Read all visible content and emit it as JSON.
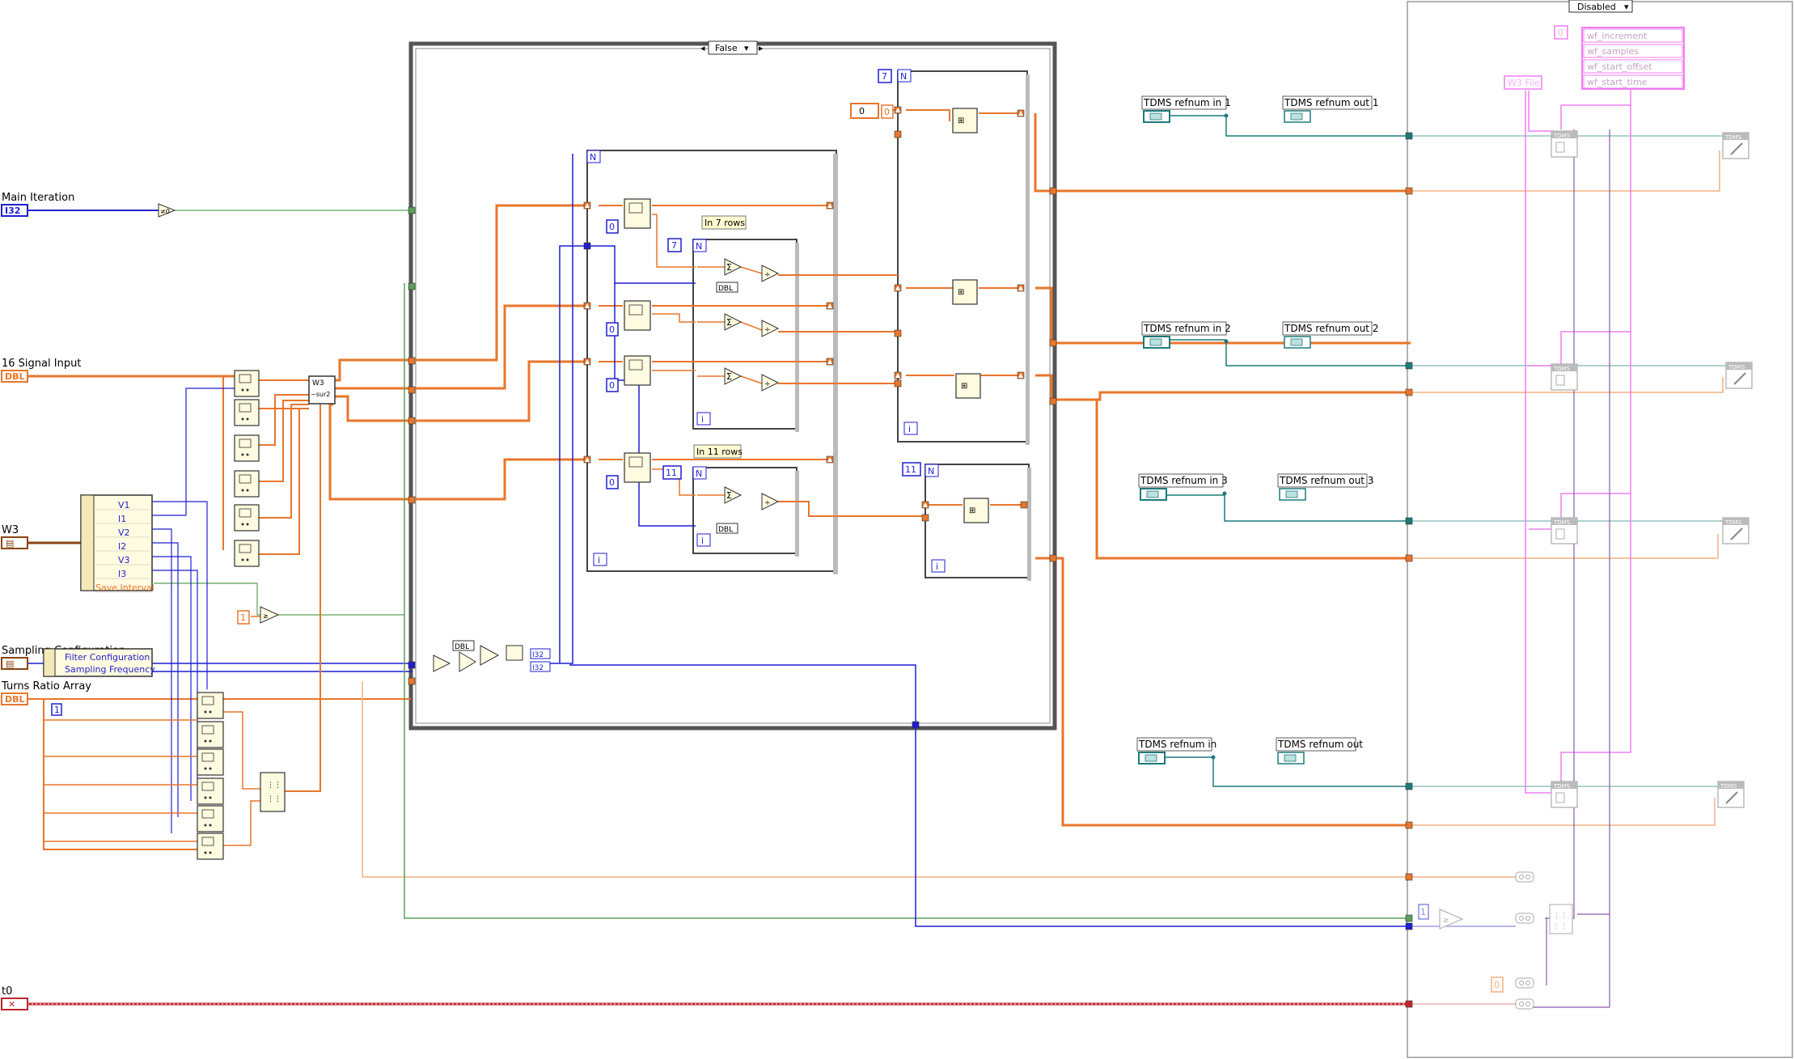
{
  "colors": {
    "orange": "#e8762b",
    "orange_light": "#f4b183",
    "blue": "#1f1fd0",
    "green": "#5aa05a",
    "teal": "#1e7a7a",
    "teal_light": "#7fb8b8",
    "red": "#c0262c",
    "pink": "#f07ef0",
    "pink_light": "#f5b3f5",
    "gray": "#777777"
  },
  "case_structure": {
    "selector": "False"
  },
  "disabled_structure": {
    "selector": "Disabled"
  },
  "controls": {
    "main_iteration": {
      "label": "Main Iteration",
      "type": "I32"
    },
    "signal_input": {
      "label": "16 Signal Input",
      "type": "DBL"
    },
    "w3": {
      "label": "W3"
    },
    "sampling_config": {
      "label": "Sampling Configuration"
    },
    "turns_ratio": {
      "label": "Turns Ratio Array",
      "type": "DBL"
    },
    "t0": {
      "label": "t0"
    }
  },
  "bundle": {
    "items": [
      "V1",
      "I1",
      "V2",
      "I2",
      "V3",
      "I3",
      "Save Interval"
    ]
  },
  "cluster_unbundle": {
    "items": [
      "Filter Configuration",
      "Sampling Frequency"
    ]
  },
  "subvi": {
    "label": "W3\n~sur2"
  },
  "constants": {
    "zero_a": "0",
    "zero_b": "0",
    "zero_c": "0",
    "zero_d": "0",
    "zero_e": "0",
    "zero_f": "0",
    "zero_g": "0",
    "one_a": "1",
    "one_b": "1",
    "one_c": "1",
    "seven_a": "7",
    "seven_b": "7",
    "eleven_a": "11",
    "eleven_b": "11"
  },
  "loops": {
    "n_label": "N",
    "i_label": "i",
    "rows7": "In 7 rows",
    "rows11": "In 11 rows"
  },
  "type_labels": {
    "dbl": "DBL",
    "i32": "I32",
    "tdms": "TDMS"
  },
  "tdms": {
    "in1": "TDMS refnum in 1",
    "out1": "TDMS refnum out 1",
    "in2": "TDMS refnum in 2",
    "out2": "TDMS refnum out 2",
    "in3": "TDMS refnum in 3",
    "out3": "TDMS refnum out 3",
    "in4": "TDMS refnum in",
    "out4": "TDMS refnum out"
  },
  "waveform": {
    "file_label": "W3 File",
    "attrs": [
      "wf_increment",
      "wf_samples",
      "wf_start_offset",
      "wf_start_time"
    ]
  }
}
